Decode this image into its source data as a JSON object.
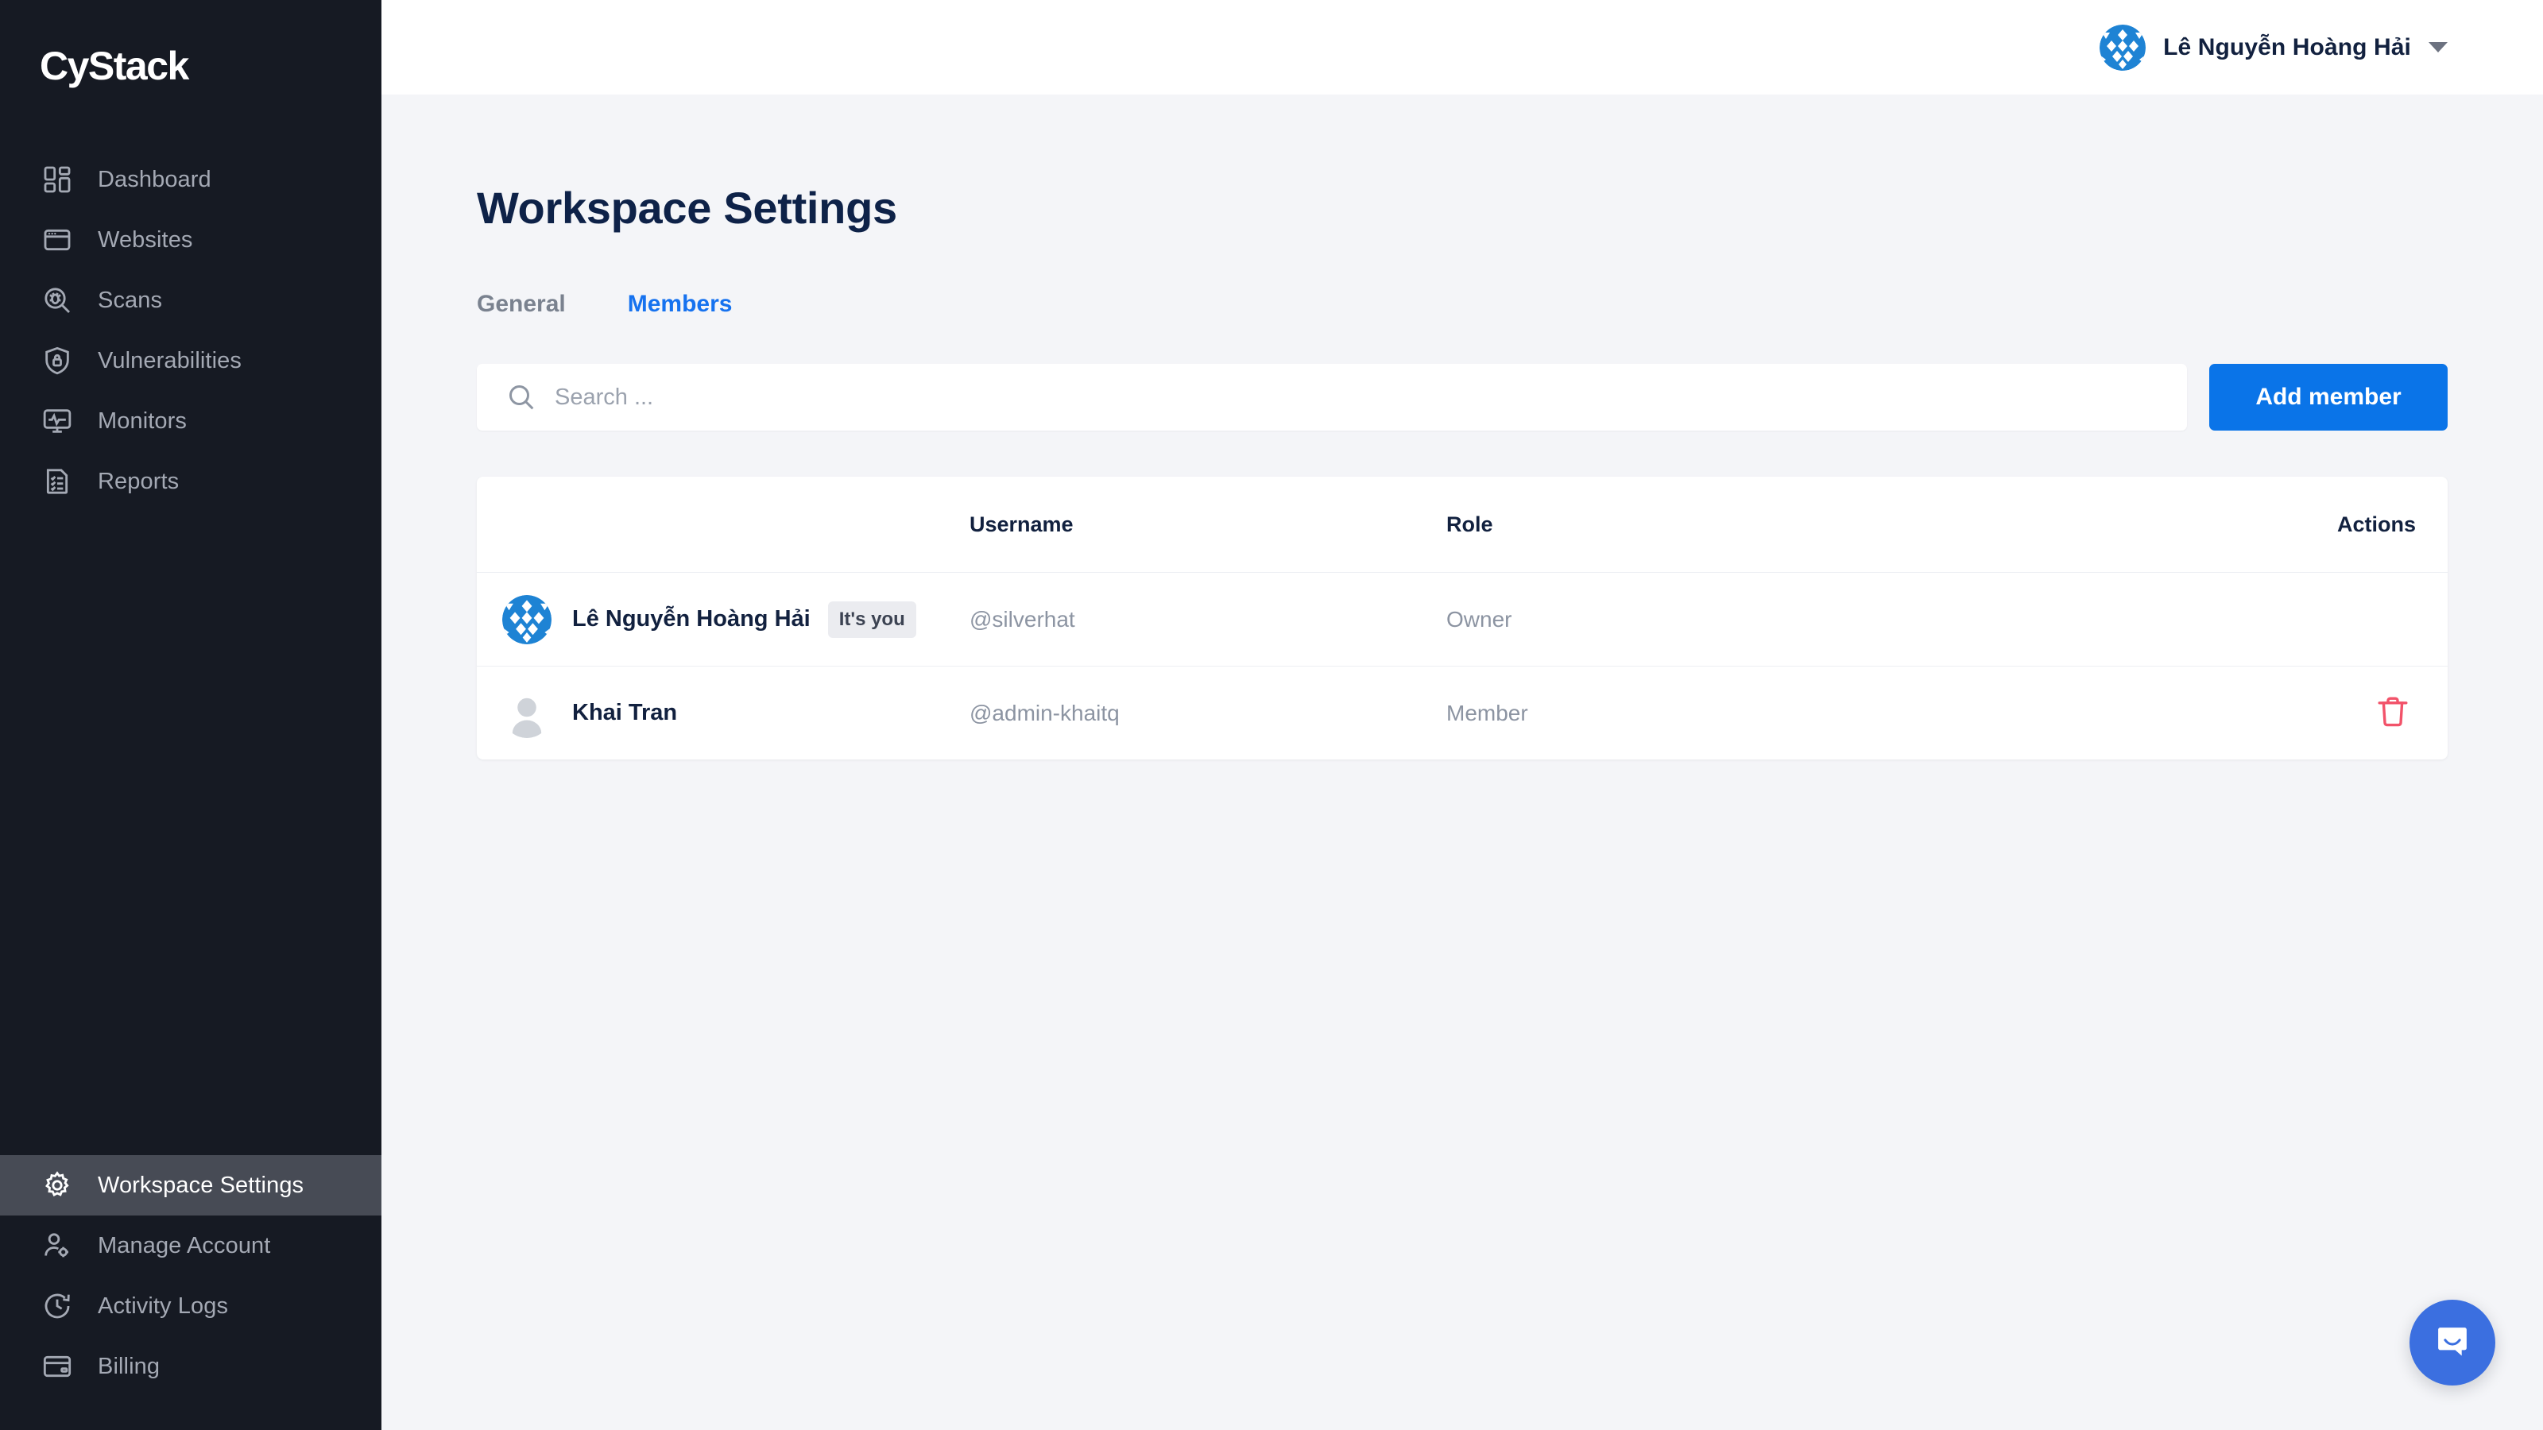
{
  "brand": {
    "name": "CyStack"
  },
  "colors": {
    "sidebar_bg": "#161A23",
    "sidebar_active_bg": "#474B55",
    "content_bg": "#F4F5F8",
    "accent_blue": "#0A74E8",
    "tab_active": "#1672EF",
    "title_navy": "#0E2248",
    "danger_red": "#F2536A",
    "annotation_red": "#FF0000"
  },
  "sidebar": {
    "items_top": [
      {
        "label": "Dashboard",
        "icon": "grid-icon",
        "active": false
      },
      {
        "label": "Websites",
        "icon": "browser-window-icon",
        "active": false
      },
      {
        "label": "Scans",
        "icon": "bug-magnifier-icon",
        "active": false
      },
      {
        "label": "Vulnerabilities",
        "icon": "shield-lock-icon",
        "active": false
      },
      {
        "label": "Monitors",
        "icon": "monitor-pulse-icon",
        "active": false
      },
      {
        "label": "Reports",
        "icon": "clipboard-checklist-icon",
        "active": false
      }
    ],
    "items_bottom": [
      {
        "label": "Workspace Settings",
        "icon": "gear-icon",
        "active": true
      },
      {
        "label": "Manage Account",
        "icon": "user-gear-icon",
        "active": false
      },
      {
        "label": "Activity Logs",
        "icon": "clock-history-icon",
        "active": false
      },
      {
        "label": "Billing",
        "icon": "credit-card-icon",
        "active": false
      }
    ]
  },
  "topbar": {
    "user_name": "Lê Nguyễn Hoàng Hải",
    "avatar_icon": "identicon-avatar",
    "caret_icon": "chevron-down-icon"
  },
  "main": {
    "page_title": "Workspace Settings",
    "tabs": [
      {
        "label": "General",
        "active": false
      },
      {
        "label": "Members",
        "active": true
      }
    ],
    "search": {
      "placeholder": "Search ...",
      "value": "",
      "icon": "search-icon"
    },
    "add_member_label": "Add member"
  },
  "table": {
    "columns": [
      "",
      "Username",
      "Role",
      "Actions"
    ],
    "headers": {
      "name": "",
      "username": "Username",
      "role": "Role",
      "actions": "Actions"
    },
    "rows": [
      {
        "name": "Lê Nguyễn Hoàng Hải",
        "badge": "It's you",
        "username": "@silverhat",
        "role": "Owner",
        "avatar": "identicon-avatar",
        "has_delete": false
      },
      {
        "name": "Khai Tran",
        "badge": "",
        "username": "@admin-khaitq",
        "role": "Member",
        "avatar": "default-person-avatar",
        "has_delete": true,
        "delete_icon": "trash-icon"
      }
    ]
  },
  "chat_widget": {
    "icon": "intercom-chat-icon",
    "label": ""
  }
}
